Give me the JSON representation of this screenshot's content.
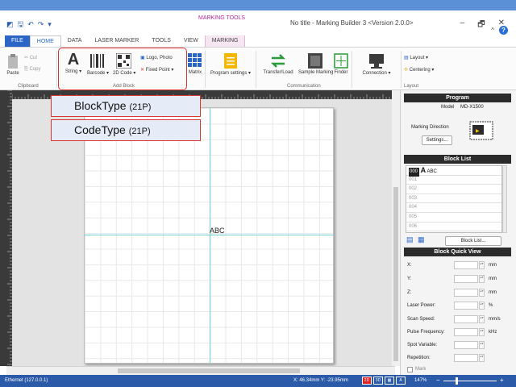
{
  "window": {
    "title": "No title - Marking Builder 3 <Version 2.0.0>",
    "context_group": "MARKING TOOLS",
    "minimize": "–",
    "maximize": "🗗",
    "close": "✕",
    "ribbon_collapse": "^",
    "help": "?"
  },
  "tabs": [
    "FILE",
    "HOME",
    "DATA",
    "LASER MARKER",
    "TOOLS",
    "VIEW",
    "MARKING"
  ],
  "ribbon": {
    "clipboard": {
      "paste": "Paste",
      "cut": "Cut",
      "copy": "Copy",
      "label": "Clipboard"
    },
    "add_block": {
      "string": "String",
      "barcode": "Barcode",
      "code2d": "2D Code",
      "logo": "Logo, Photo",
      "fixed_point": "Fixed Point",
      "label": "Add Block"
    },
    "matrix": "Matrix",
    "program_settings": "Program settings",
    "communication": {
      "transfer": "Transfer/Load",
      "sample": "Sample Marking",
      "finder": "Finder",
      "label": "Communication"
    },
    "connection": "Connection",
    "layout": {
      "layout": "Layout",
      "centering": "Centering",
      "label": "Layout"
    }
  },
  "popup": {
    "item1_main": "BlockType",
    "item1_size": "(21P)",
    "item2_main": "CodeType",
    "item2_size": "(21P)"
  },
  "canvas": {
    "text": "ABC"
  },
  "panel": {
    "program": {
      "header": "Program",
      "model_label": "Model",
      "model_value": "MD-X1500",
      "direction_label": "Marking Direction",
      "settings_btn": "Settings..."
    },
    "block_list": {
      "header": "Block List",
      "items": [
        {
          "num": "000",
          "icon": "A",
          "text": "ABC"
        },
        {
          "num": "001",
          "icon": "",
          "text": ""
        },
        {
          "num": "002",
          "icon": "",
          "text": ""
        },
        {
          "num": "003",
          "icon": "",
          "text": ""
        },
        {
          "num": "004",
          "icon": "",
          "text": ""
        },
        {
          "num": "005",
          "icon": "",
          "text": ""
        },
        {
          "num": "006",
          "icon": "",
          "text": ""
        }
      ],
      "btn": "Block List..."
    },
    "quick_view": {
      "header": "Block Quick View",
      "fields": [
        {
          "label": "X:",
          "unit": "mm"
        },
        {
          "label": "Y:",
          "unit": "mm"
        },
        {
          "label": "Z:",
          "unit": "mm"
        },
        {
          "label": "Laser Power:",
          "unit": "%"
        },
        {
          "label": "Scan Speed:",
          "unit": "mm/s"
        },
        {
          "label": "Pulse Frequency:",
          "unit": "kHz"
        },
        {
          "label": "Spot Variable:",
          "unit": ""
        },
        {
          "label": "Repetition:",
          "unit": ""
        }
      ],
      "mark": "Mark"
    }
  },
  "status": {
    "connection": "Ethernet (127.0.0.1)",
    "coords": "X: 46.34mm Y: -23.95mm",
    "view_2d": "2D",
    "view_3d": "3D",
    "zoom": "147%"
  },
  "colors": {
    "accent": "#2b66c7",
    "highlight": "#dd3333",
    "status": "#2b5aa8"
  }
}
